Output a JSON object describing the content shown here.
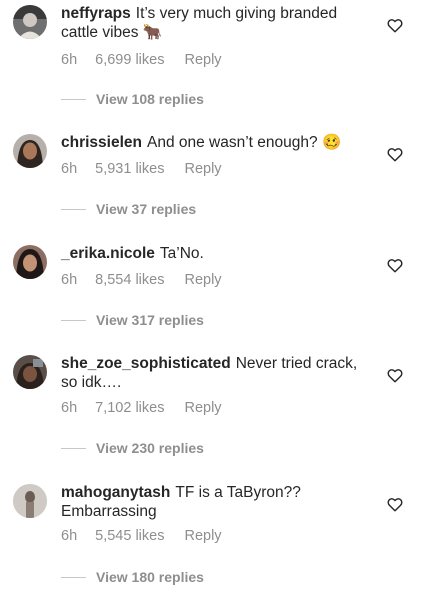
{
  "comments": [
    {
      "username": "neffyraps",
      "text": "It’s very much giving branded cattle vibes 🐂",
      "time": "6h",
      "likes": "6,699 likes",
      "reply": "Reply",
      "view_replies": "View 108 replies"
    },
    {
      "username": "chrissielen",
      "text": "And one wasn’t enough? 🥴",
      "time": "6h",
      "likes": "5,931 likes",
      "reply": "Reply",
      "view_replies": "View 37 replies"
    },
    {
      "username": "_erika.nicole",
      "text": "Ta’No.",
      "time": "6h",
      "likes": "8,554 likes",
      "reply": "Reply",
      "view_replies": "View 317 replies"
    },
    {
      "username": "she_zoe_sophisticated",
      "text": "Never tried crack, so idk….",
      "time": "6h",
      "likes": "7,102 likes",
      "reply": "Reply",
      "view_replies": "View 230 replies"
    },
    {
      "username": "mahoganytash",
      "text": "TF is a TaByron?? Embarrassing",
      "time": "6h",
      "likes": "5,545 likes",
      "reply": "Reply",
      "view_replies": "View 180 replies"
    }
  ],
  "icons": {
    "like": "heart-outline-icon"
  },
  "colors": {
    "text": "#262626",
    "secondary": "#8e8e8e",
    "divider": "#c7c7c7"
  }
}
